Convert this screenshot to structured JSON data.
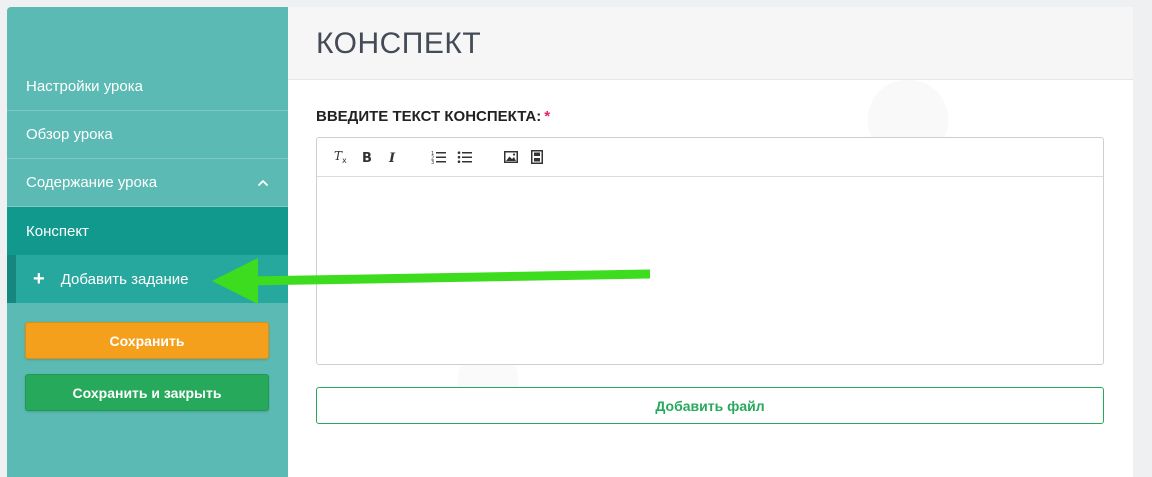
{
  "sidebar": {
    "items": [
      {
        "label": "Настройки урока"
      },
      {
        "label": "Обзор урока"
      },
      {
        "label": "Содержание урока"
      },
      {
        "label": "Конспект"
      },
      {
        "label": "Добавить задание",
        "prefix": "+"
      }
    ],
    "save_label": "Сохранить",
    "save_close_label": "Сохранить и закрыть"
  },
  "main": {
    "title": "КОНСПЕКТ",
    "field_label": "ВВЕДИТЕ ТЕКСТ КОНСПЕКТА:",
    "required_mark": "*",
    "toolbar_icons": [
      "clear-format-icon",
      "bold-icon",
      "italic-icon",
      "ordered-list-icon",
      "unordered-list-icon",
      "image-icon",
      "video-icon"
    ],
    "editor_content": "",
    "add_file_label": "Добавить файл"
  },
  "colors": {
    "sidebar": "#5bbab3",
    "active": "#11998e",
    "save": "#f5a01d",
    "save_close": "#27a95c",
    "arrow": "#3ddc1f",
    "required": "#e0245e"
  }
}
